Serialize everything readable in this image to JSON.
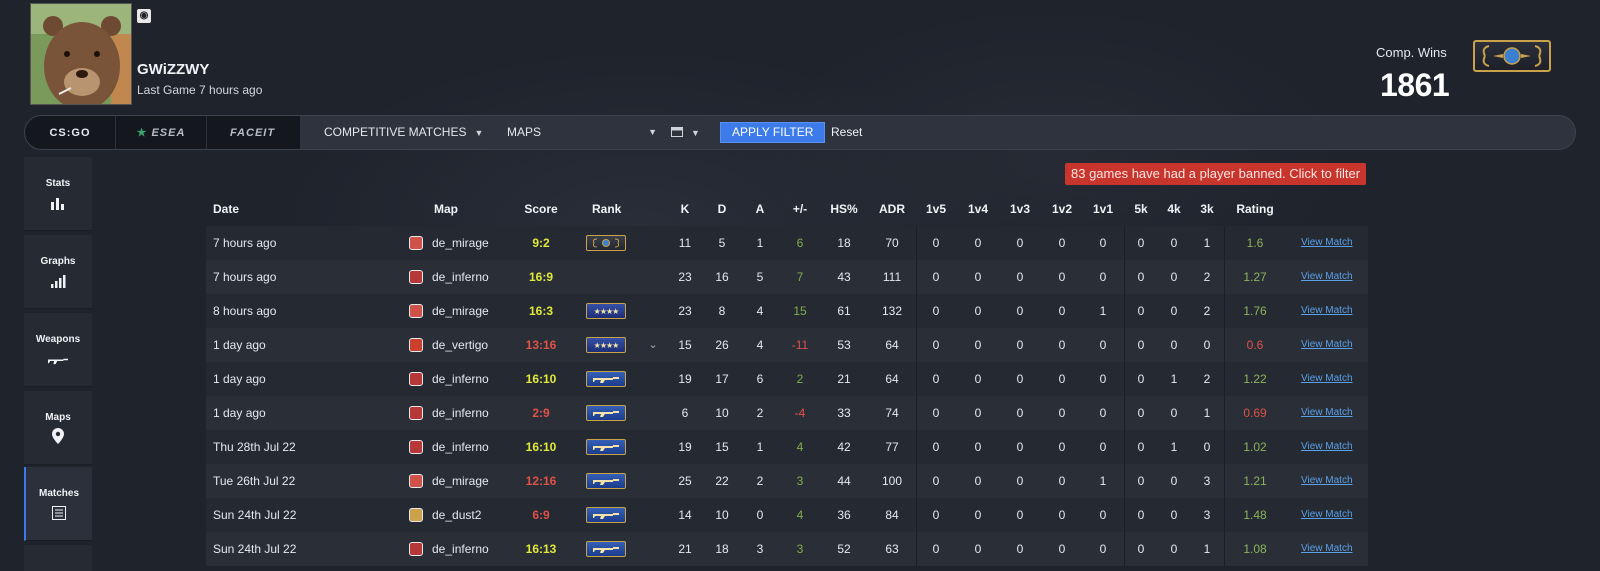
{
  "player": {
    "name": "GWiZZWY",
    "last_game": "Last Game 7 hours ago",
    "steam_badge": "steam-icon"
  },
  "stats": {
    "comp_wins_label": "Comp. Wins",
    "comp_wins_value": "1861"
  },
  "filter": {
    "sources": [
      "CS:GO",
      "ESEA",
      "FACEIT"
    ],
    "match_type": "COMPETITIVE MATCHES",
    "maps": "MAPS",
    "apply": "APPLY FILTER",
    "reset": "Reset"
  },
  "sidebar": {
    "items": [
      {
        "label": "Stats",
        "icon": "bar-chart-icon"
      },
      {
        "label": "Graphs",
        "icon": "signal-bars-icon"
      },
      {
        "label": "Weapons",
        "icon": "rifle-icon"
      },
      {
        "label": "Maps",
        "icon": "map-pin-icon"
      },
      {
        "label": "Matches",
        "icon": "list-icon"
      }
    ]
  },
  "ban_notice": "83 games have had a player banned. Click to filter",
  "table": {
    "headers": [
      "Date",
      "Map",
      "Score",
      "Rank",
      "K",
      "D",
      "A",
      "+/-",
      "HS%",
      "ADR",
      "1v5",
      "1v4",
      "1v3",
      "1v2",
      "1v1",
      "5k",
      "4k",
      "3k",
      "Rating"
    ],
    "view_label": "View Match",
    "rows": [
      {
        "date": "7 hours ago",
        "map": "de_mirage",
        "map_icon": "mirage-icon",
        "score": "9:2",
        "result": "win",
        "rank": "gold",
        "k": "11",
        "d": "5",
        "a": "1",
        "pm": "6",
        "pm_sign": "pos",
        "hs": "18",
        "adr": "70",
        "c5": "0",
        "c4": "0",
        "c3": "0",
        "c2": "0",
        "c1": "0",
        "k5": "0",
        "k4": "0",
        "k3": "1",
        "rating": "1.6",
        "rating_class": "good"
      },
      {
        "date": "7 hours ago",
        "map": "de_inferno",
        "map_icon": "inferno-icon",
        "score": "16:9",
        "result": "win",
        "rank": "",
        "k": "23",
        "d": "16",
        "a": "5",
        "pm": "7",
        "pm_sign": "pos",
        "hs": "43",
        "adr": "111",
        "c5": "0",
        "c4": "0",
        "c3": "0",
        "c2": "0",
        "c1": "0",
        "k5": "0",
        "k4": "0",
        "k3": "2",
        "rating": "1.27",
        "rating_class": "good"
      },
      {
        "date": "8 hours ago",
        "map": "de_mirage",
        "map_icon": "mirage-icon",
        "score": "16:3",
        "result": "win",
        "rank": "nova",
        "k": "23",
        "d": "8",
        "a": "4",
        "pm": "15",
        "pm_sign": "pos",
        "hs": "61",
        "adr": "132",
        "c5": "0",
        "c4": "0",
        "c3": "0",
        "c2": "0",
        "c1": "1",
        "k5": "0",
        "k4": "0",
        "k3": "2",
        "rating": "1.76",
        "rating_class": "good"
      },
      {
        "date": "1 day ago",
        "map": "de_vertigo",
        "map_icon": "vertigo-icon",
        "score": "13:16",
        "result": "loss",
        "rank": "nova",
        "expand": "⌄",
        "k": "15",
        "d": "26",
        "a": "4",
        "pm": "-11",
        "pm_sign": "neg",
        "hs": "53",
        "adr": "64",
        "c5": "0",
        "c4": "0",
        "c3": "0",
        "c2": "0",
        "c1": "0",
        "k5": "0",
        "k4": "0",
        "k3": "0",
        "rating": "0.6",
        "rating_class": "bad"
      },
      {
        "date": "1 day ago",
        "map": "de_inferno",
        "map_icon": "inferno-icon",
        "score": "16:10",
        "result": "win",
        "rank": "ak",
        "k": "19",
        "d": "17",
        "a": "6",
        "pm": "2",
        "pm_sign": "pos",
        "hs": "21",
        "adr": "64",
        "c5": "0",
        "c4": "0",
        "c3": "0",
        "c2": "0",
        "c1": "0",
        "k5": "0",
        "k4": "1",
        "k3": "2",
        "rating": "1.22",
        "rating_class": "good"
      },
      {
        "date": "1 day ago",
        "map": "de_inferno",
        "map_icon": "inferno-icon",
        "score": "2:9",
        "result": "loss",
        "rank": "ak",
        "k": "6",
        "d": "10",
        "a": "2",
        "pm": "-4",
        "pm_sign": "neg",
        "hs": "33",
        "adr": "74",
        "c5": "0",
        "c4": "0",
        "c3": "0",
        "c2": "0",
        "c1": "0",
        "k5": "0",
        "k4": "0",
        "k3": "1",
        "rating": "0.69",
        "rating_class": "bad"
      },
      {
        "date": "Thu 28th Jul 22",
        "map": "de_inferno",
        "map_icon": "inferno-icon",
        "score": "16:10",
        "result": "win",
        "rank": "ak",
        "k": "19",
        "d": "15",
        "a": "1",
        "pm": "4",
        "pm_sign": "pos",
        "hs": "42",
        "adr": "77",
        "c5": "0",
        "c4": "0",
        "c3": "0",
        "c2": "0",
        "c1": "0",
        "k5": "0",
        "k4": "1",
        "k3": "0",
        "rating": "1.02",
        "rating_class": "good"
      },
      {
        "date": "Tue 26th Jul 22",
        "map": "de_mirage",
        "map_icon": "mirage-icon",
        "score": "12:16",
        "result": "loss",
        "rank": "ak",
        "k": "25",
        "d": "22",
        "a": "2",
        "pm": "3",
        "pm_sign": "pos",
        "hs": "44",
        "adr": "100",
        "c5": "0",
        "c4": "0",
        "c3": "0",
        "c2": "0",
        "c1": "1",
        "k5": "0",
        "k4": "0",
        "k3": "3",
        "rating": "1.21",
        "rating_class": "good"
      },
      {
        "date": "Sun 24th Jul 22",
        "map": "de_dust2",
        "map_icon": "dust2-icon",
        "score": "6:9",
        "result": "loss",
        "rank": "ak",
        "k": "14",
        "d": "10",
        "a": "0",
        "pm": "4",
        "pm_sign": "pos",
        "hs": "36",
        "adr": "84",
        "c5": "0",
        "c4": "0",
        "c3": "0",
        "c2": "0",
        "c1": "0",
        "k5": "0",
        "k4": "0",
        "k3": "3",
        "rating": "1.48",
        "rating_class": "good"
      },
      {
        "date": "Sun 24th Jul 22",
        "map": "de_inferno",
        "map_icon": "inferno-icon",
        "score": "16:13",
        "result": "win",
        "rank": "ak",
        "k": "21",
        "d": "18",
        "a": "3",
        "pm": "3",
        "pm_sign": "pos",
        "hs": "52",
        "adr": "63",
        "c5": "0",
        "c4": "0",
        "c3": "0",
        "c2": "0",
        "c1": "0",
        "k5": "0",
        "k4": "0",
        "k3": "1",
        "rating": "1.08",
        "rating_class": "good"
      }
    ]
  },
  "colors": {
    "accent": "#3d7bea",
    "win": "#e1ea3b",
    "loss": "#e0514a",
    "positive": "#7fb04b",
    "banner": "#c8352d"
  }
}
